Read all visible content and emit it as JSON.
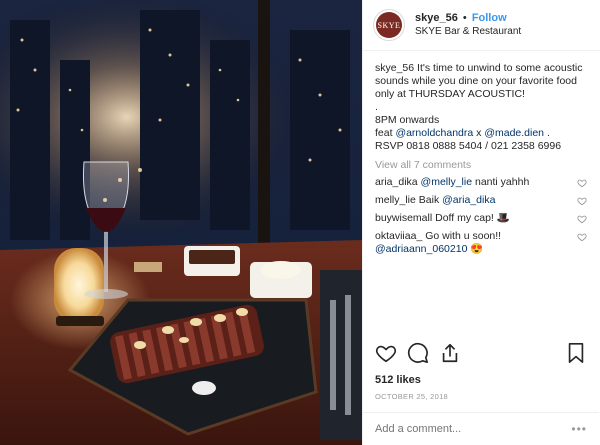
{
  "post": {
    "image_alt": "Steak dinner on a slate board next to a glass of red wine and a candle lamp, city lights at night behind the window"
  },
  "header": {
    "username": "skye_56",
    "separator": "•",
    "follow_label": "Follow",
    "location": "SKYE Bar & Restaurant",
    "avatar_text": "SKYE"
  },
  "caption": {
    "username": "skye_56",
    "line1": "It's time to unwind to some acoustic sounds while you dine on your favorite food only at THURSDAY ACOUSTIC!",
    "line2": ".",
    "line3": "8PM onwards",
    "feat_prefix": "feat",
    "feat_mention1": "@arnoldchandra",
    "feat_join": "x",
    "feat_mention2": "@made.dien",
    "feat_suffix": ".",
    "line5": "RSVP 0818 0888 5404 / 021 2358 6996"
  },
  "view_all_comments": "View all 7 comments",
  "comments": [
    {
      "user": "aria_dika",
      "mention": "@melly_lie",
      "text": "nanti yahhh"
    },
    {
      "user": "melly_lie",
      "text": "Baik",
      "mention": "@aria_dika"
    },
    {
      "user": "buywisemall",
      "text": "Doff my cap! 🎩"
    },
    {
      "user": "oktaviiaa_",
      "text": "Go with u soon!!",
      "mention": "@adriaann_060210",
      "emoji": "😍"
    }
  ],
  "likes": "512 likes",
  "date": "OCTOBER 25, 2018",
  "add_comment": {
    "placeholder": "Add a comment..."
  },
  "more_label": "•••",
  "colors": {
    "link": "#3897f0",
    "mention": "#003569",
    "muted": "#999999"
  }
}
